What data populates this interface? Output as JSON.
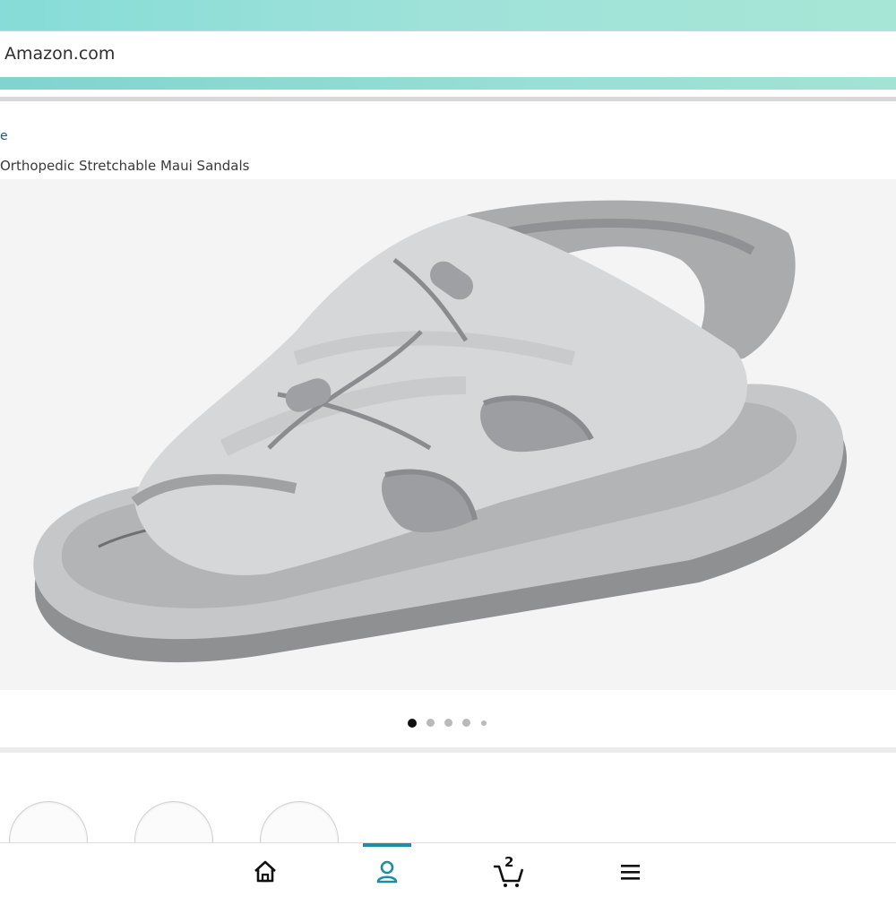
{
  "browser": {
    "address": "Amazon.com"
  },
  "page": {
    "breadcrumb": "e",
    "product_title": "Orthopedic Stretchable Maui Sandals"
  },
  "carousel": {
    "total_dots": 5,
    "active_index": 0
  },
  "bottom_nav": {
    "items": [
      {
        "icon": "home-icon"
      },
      {
        "icon": "account-icon",
        "active": true
      },
      {
        "icon": "cart-icon",
        "count": "2"
      },
      {
        "icon": "menu-icon"
      }
    ],
    "accent_color": "#1e8ea0"
  }
}
